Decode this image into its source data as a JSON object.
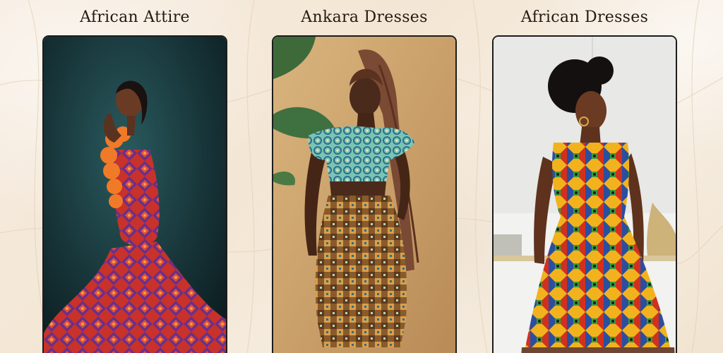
{
  "categories": [
    {
      "title": "African Attire",
      "photo": "woman-in-orange-mermaid-gown-photo"
    },
    {
      "title": "Ankara Dresses",
      "photo": "woman-in-ankara-crop-top-and-skirt-photo"
    },
    {
      "title": "African Dresses",
      "photo": "woman-in-kente-halter-dress-photo"
    }
  ]
}
